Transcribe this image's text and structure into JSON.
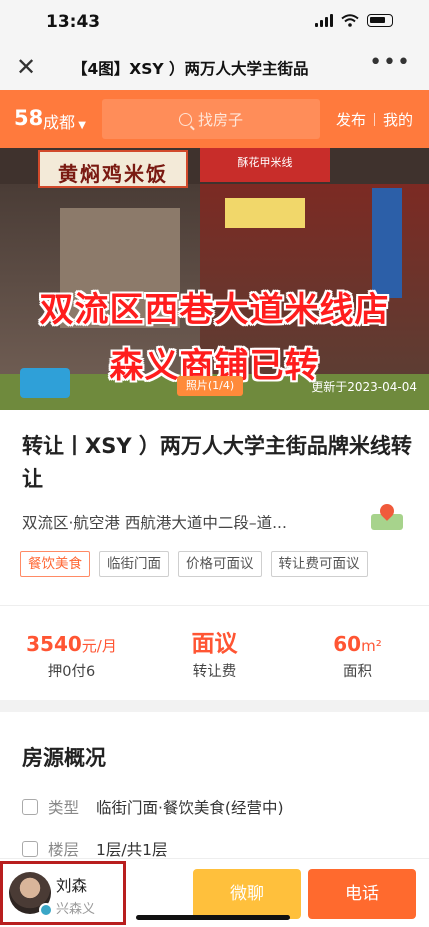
{
  "status_bar": {
    "time": "13:43"
  },
  "nav": {
    "close_icon": "close-icon",
    "title": "【4图】XSY ）两万人大学主街品",
    "more_icon": "more-dots-icon"
  },
  "header": {
    "logo": "58",
    "city": "成都",
    "search_placeholder": "找房子",
    "publish": "发布",
    "mine": "我的",
    "accent_color": "#ff7a3d"
  },
  "photo": {
    "sign_left": "黄焖鸡米饭",
    "sign_right": "酥花甲米线",
    "overlay_line1": "双流区西巷大道米线店",
    "overlay_line2": "森义商铺已转",
    "count": "照片(1/4)",
    "updated": "更新于2023-04-04"
  },
  "listing": {
    "title": "转让丨XSY ）两万人大学主街品牌米线转让",
    "address": "双流区·航空港  西航港大道中二段–道...",
    "tags": [
      "餐饮美食",
      "临街门面",
      "价格可面议",
      "转让费可面议"
    ]
  },
  "stats": {
    "rent_value": "3540",
    "rent_unit": "元/月",
    "rent_label": "押0付6",
    "transfer_value": "面议",
    "transfer_label": "转让费",
    "area_value": "60",
    "area_unit": "m²",
    "area_label": "面积"
  },
  "overview": {
    "title": "房源概况",
    "type_label": "类型",
    "type_value": "临街门面·餐饮美食(经营中)",
    "floor_label": "楼层",
    "floor_value": "1层/共1层"
  },
  "bottom": {
    "agent_name": "刘森",
    "agent_company": "兴森义",
    "chat": "微聊",
    "call": "电话"
  }
}
